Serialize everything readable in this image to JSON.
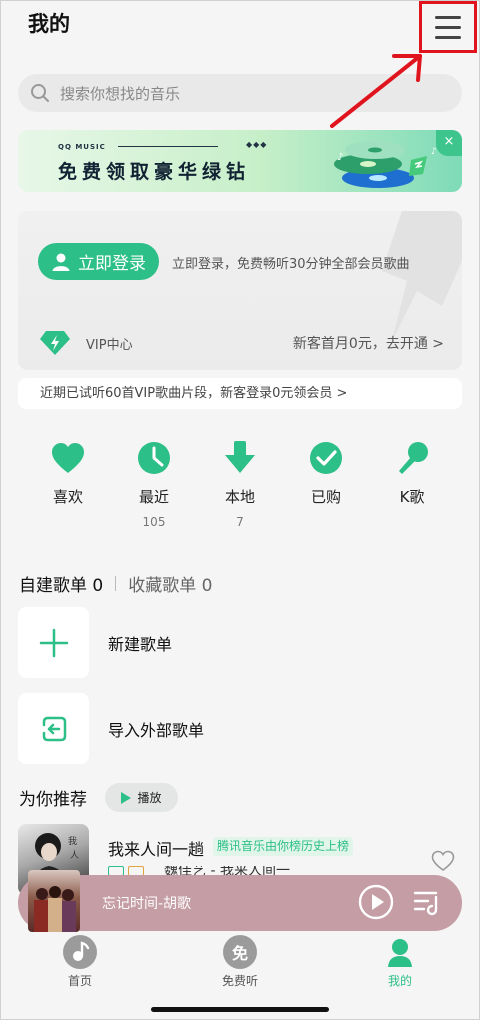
{
  "header": {
    "title": "我的",
    "menu_icon": "hamburger-menu-icon"
  },
  "search": {
    "placeholder": "搜索你想找的音乐",
    "icon": "search-icon"
  },
  "banner": {
    "brand": "QQ MUSIC",
    "title": "免费领取豪华绿钻",
    "close_label": "×",
    "diamonds": "◆◆◆"
  },
  "login_card": {
    "button_label": "立即登录",
    "description": "立即登录，免费畅听30分钟全部会员歌曲",
    "vip_label": "VIP中心",
    "vip_offer": "新客首月0元，去开通 >"
  },
  "trial_notice": "近期已试听60首VIP歌曲片段，新客登录0元领会员 >",
  "shortcuts": [
    {
      "label": "喜欢",
      "count": "",
      "icon": "heart-icon"
    },
    {
      "label": "最近",
      "count": "105",
      "icon": "clock-icon"
    },
    {
      "label": "本地",
      "count": "7",
      "icon": "download-icon"
    },
    {
      "label": "已购",
      "count": "",
      "icon": "check-circle-icon"
    },
    {
      "label": "K歌",
      "count": "",
      "icon": "microphone-icon"
    }
  ],
  "playlists": {
    "tab_created": "自建歌单 0",
    "tab_collected": "收藏歌单 0",
    "new_label": "新建歌单",
    "import_label": "导入外部歌单"
  },
  "recommend": {
    "title": "为你推荐",
    "play_label": "播放",
    "song": "我来人间一趟",
    "tag": "腾讯音乐由你榜历史上榜",
    "artist_line": "魏佳艺 - 我来人间一趟"
  },
  "player": {
    "now_playing": "忘记时间-胡歌"
  },
  "nav": [
    {
      "label": "首页",
      "icon": "home-icon",
      "glyph": "",
      "active": false
    },
    {
      "label": "免费听",
      "icon": "free-listen-icon",
      "glyph": "免",
      "active": false
    },
    {
      "label": "我的",
      "icon": "profile-icon",
      "glyph": "",
      "active": true
    }
  ],
  "colors": {
    "brand_green": "#2cbf87",
    "annotation_red": "#e0141c",
    "player_bg": "#c49da5"
  }
}
